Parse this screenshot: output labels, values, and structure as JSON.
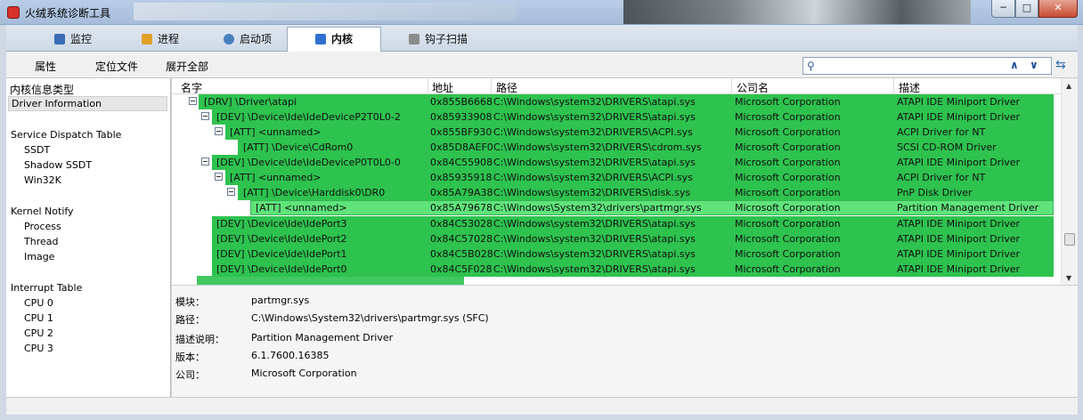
{
  "window": {
    "title": "火绒系统诊断工具",
    "min": "─",
    "max": "□",
    "close": "✕"
  },
  "tabs": [
    {
      "label": "监控",
      "color": "#3a6db5"
    },
    {
      "label": "进程",
      "color": "#e0a02a"
    },
    {
      "label": "启动项",
      "color": "#4a7fbf"
    },
    {
      "label": "内核",
      "color": "#2f6fd0"
    },
    {
      "label": "钩子扫描",
      "color": "#8c8c8c"
    }
  ],
  "toolbar": {
    "props": "属性",
    "locate": "定位文件",
    "expand": "展开全部",
    "search_value": "",
    "up": "∧",
    "down": "∨",
    "refresh": "⇆",
    "mag": "⚲"
  },
  "left": {
    "header": "内核信息类型",
    "items": [
      "Driver Information",
      "Service Dispatch Table",
      "SSDT",
      "Shadow SSDT",
      "Win32K",
      "Kernel Notify",
      "Process",
      "Thread",
      "Image",
      "Interrupt Table",
      "CPU 0",
      "CPU 1",
      "CPU 2",
      "CPU 3"
    ]
  },
  "table": {
    "columns": [
      "名字",
      "地址",
      "路径",
      "公司名",
      "描述"
    ],
    "rows": [
      {
        "name": "[DRV] \\Driver\\atapi",
        "addr": "0x855B6668",
        "path": "C:\\Windows\\system32\\DRIVERS\\atapi.sys",
        "company": "Microsoft Corporation",
        "desc": "ATAPI IDE Miniport Driver"
      },
      {
        "name": "[DEV] \\Device\\Ide\\IdeDeviceP2T0L0-2",
        "addr": "0x85933908",
        "path": "C:\\Windows\\system32\\DRIVERS\\atapi.sys",
        "company": "Microsoft Corporation",
        "desc": "ATAPI IDE Miniport Driver"
      },
      {
        "name": "[ATT] <unnamed>",
        "addr": "0x855BF930",
        "path": "C:\\Windows\\system32\\DRIVERS\\ACPI.sys",
        "company": "Microsoft Corporation",
        "desc": "ACPI Driver for NT"
      },
      {
        "name": "[ATT] \\Device\\CdRom0",
        "addr": "0x85D8AEF0",
        "path": "C:\\Windows\\system32\\DRIVERS\\cdrom.sys",
        "company": "Microsoft Corporation",
        "desc": "SCSI CD-ROM Driver"
      },
      {
        "name": "[DEV] \\Device\\Ide\\IdeDeviceP0T0L0-0",
        "addr": "0x84C55908",
        "path": "C:\\Windows\\system32\\DRIVERS\\atapi.sys",
        "company": "Microsoft Corporation",
        "desc": "ATAPI IDE Miniport Driver"
      },
      {
        "name": "[ATT] <unnamed>",
        "addr": "0x85935918",
        "path": "C:\\Windows\\system32\\DRIVERS\\ACPI.sys",
        "company": "Microsoft Corporation",
        "desc": "ACPI Driver for NT"
      },
      {
        "name": "[ATT] \\Device\\Harddisk0\\DR0",
        "addr": "0x85A79A38",
        "path": "C:\\Windows\\system32\\DRIVERS\\disk.sys",
        "company": "Microsoft Corporation",
        "desc": "PnP Disk Driver"
      },
      {
        "name": "[ATT] <unnamed>",
        "addr": "0x85A79678",
        "path": "C:\\Windows\\System32\\drivers\\partmgr.sys",
        "company": "Microsoft Corporation",
        "desc": "Partition Management Driver"
      },
      {
        "name": "[DEV] \\Device\\Ide\\IdePort3",
        "addr": "0x84C53028",
        "path": "C:\\Windows\\system32\\DRIVERS\\atapi.sys",
        "company": "Microsoft Corporation",
        "desc": "ATAPI IDE Miniport Driver"
      },
      {
        "name": "[DEV] \\Device\\Ide\\IdePort2",
        "addr": "0x84C57028",
        "path": "C:\\Windows\\system32\\DRIVERS\\atapi.sys",
        "company": "Microsoft Corporation",
        "desc": "ATAPI IDE Miniport Driver"
      },
      {
        "name": "[DEV] \\Device\\Ide\\IdePort1",
        "addr": "0x84C5B028",
        "path": "C:\\Windows\\system32\\DRIVERS\\atapi.sys",
        "company": "Microsoft Corporation",
        "desc": "ATAPI IDE Miniport Driver"
      },
      {
        "name": "[DEV] \\Device\\Ide\\IdePort0",
        "addr": "0x84C5F028",
        "path": "C:\\Windows\\system32\\DRIVERS\\atapi.sys",
        "company": "Microsoft Corporation",
        "desc": "ATAPI IDE Miniport Driver"
      }
    ]
  },
  "details": {
    "labels": [
      "模块：",
      "路径：",
      "描述说明：",
      "版本：",
      "公司："
    ],
    "values": [
      "partmgr.sys",
      "C:\\Windows\\System32\\drivers\\partmgr.sys (SFC)",
      "Partition Management Driver",
      "6.1.7600.16385",
      "Microsoft Corporation"
    ]
  },
  "colors": {
    "row_green": "#2ec24f",
    "row_selected": "#5fe37a"
  }
}
